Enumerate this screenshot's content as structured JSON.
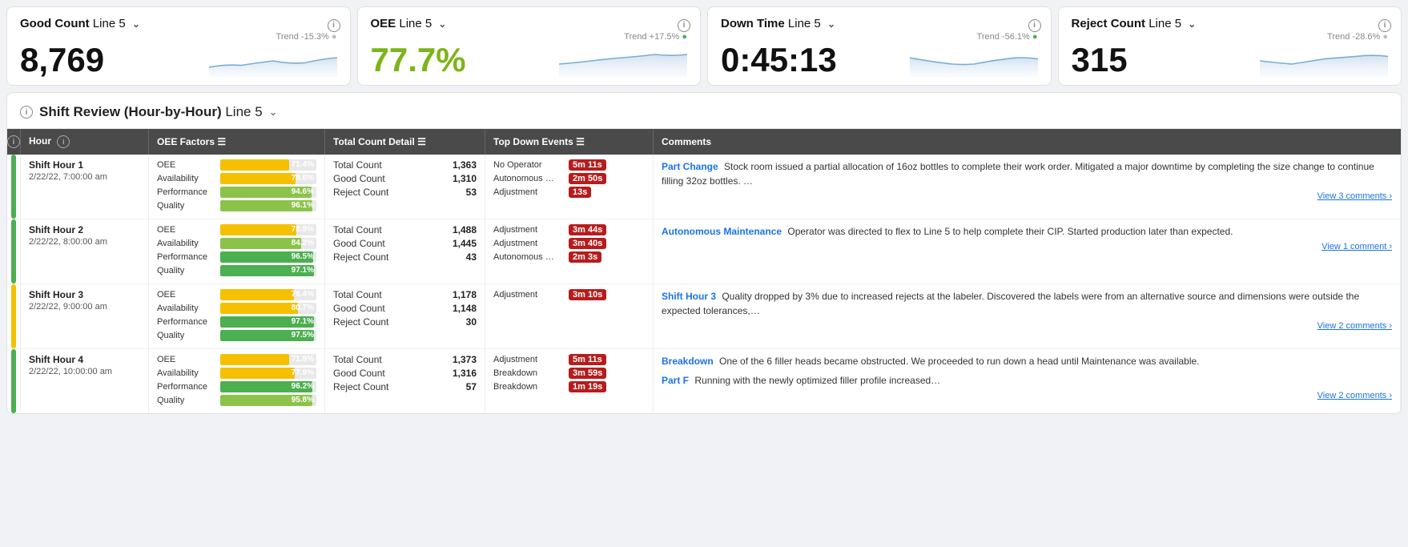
{
  "kpis": [
    {
      "id": "good-count",
      "title": "Good Count",
      "subtitle": "Line 5",
      "value": "8,769",
      "trend": "Trend -15.3%",
      "trend_direction": "gray",
      "value_color": "default"
    },
    {
      "id": "oee",
      "title": "OEE",
      "subtitle": "Line 5",
      "value": "77.7%",
      "trend": "Trend +17.5%",
      "trend_direction": "green",
      "value_color": "green"
    },
    {
      "id": "down-time",
      "title": "Down Time",
      "subtitle": "Line 5",
      "value": "0:45:13",
      "trend": "Trend -56.1%",
      "trend_direction": "green",
      "value_color": "default"
    },
    {
      "id": "reject-count",
      "title": "Reject Count",
      "subtitle": "Line 5",
      "value": "315",
      "trend": "Trend -28.6%",
      "trend_direction": "gray",
      "value_color": "default"
    }
  ],
  "shift_review": {
    "title": "Shift Review (Hour-by-Hour)",
    "subtitle": "Line 5",
    "columns": {
      "hour": "Hour",
      "oee_factors": "OEE Factors",
      "count_detail": "Total Count Detail",
      "down_events": "Top Down Events",
      "comments": "Comments"
    },
    "rows": [
      {
        "indicator": "green",
        "hour_label": "Shift Hour 1",
        "hour_date": "2/22/22, 7:00:00 am",
        "oee_factors": [
          {
            "label": "OEE",
            "pct": 71.4,
            "display": "71.4%",
            "color": "yellow"
          },
          {
            "label": "Availability",
            "pct": 78.6,
            "display": "78.6%",
            "color": "yellow"
          },
          {
            "label": "Performance",
            "pct": 94.6,
            "display": "94.6%",
            "color": "green-mid"
          },
          {
            "label": "Quality",
            "pct": 96.1,
            "display": "96.1%",
            "color": "green-mid"
          }
        ],
        "counts": [
          {
            "label": "Total Count",
            "value": "1,363"
          },
          {
            "label": "Good Count",
            "value": "1,310"
          },
          {
            "label": "Reject Count",
            "value": "53"
          }
        ],
        "down_events": [
          {
            "label": "No Operator",
            "time": "5m 11s"
          },
          {
            "label": "Autonomous …",
            "time": "2m 50s"
          },
          {
            "label": "Adjustment",
            "time": "13s"
          }
        ],
        "comments": [
          {
            "type": "Part Change",
            "text": "Stock room issued a partial allocation of 16oz bottles to complete their work order. Mitigated a major downtime by completing the size change to continue filling 32oz bottles. …",
            "view_link": "View 3 comments"
          }
        ]
      },
      {
        "indicator": "green",
        "hour_label": "Shift Hour 2",
        "hour_date": "2/22/22, 8:00:00 am",
        "oee_factors": [
          {
            "label": "OEE",
            "pct": 78.9,
            "display": "78.9%",
            "color": "yellow"
          },
          {
            "label": "Availability",
            "pct": 84.2,
            "display": "84.2%",
            "color": "green-mid"
          },
          {
            "label": "Performance",
            "pct": 96.5,
            "display": "96.5%",
            "color": "green-dark"
          },
          {
            "label": "Quality",
            "pct": 97.1,
            "display": "97.1%",
            "color": "green-dark"
          }
        ],
        "counts": [
          {
            "label": "Total Count",
            "value": "1,488"
          },
          {
            "label": "Good Count",
            "value": "1,445"
          },
          {
            "label": "Reject Count",
            "value": "43"
          }
        ],
        "down_events": [
          {
            "label": "Adjustment",
            "time": "3m 44s"
          },
          {
            "label": "Adjustment",
            "time": "3m 40s"
          },
          {
            "label": "Autonomous …",
            "time": "2m 3s"
          }
        ],
        "comments": [
          {
            "type": "Autonomous Maintenance",
            "text": "Operator was directed to flex to Line 5 to help complete their CIP. Started production later than expected.",
            "view_link": "View 1 comment"
          }
        ]
      },
      {
        "indicator": "yellow",
        "hour_label": "Shift Hour 3",
        "hour_date": "2/22/22, 9:00:00 am",
        "oee_factors": [
          {
            "label": "OEE",
            "pct": 76.4,
            "display": "76.4%",
            "color": "yellow"
          },
          {
            "label": "Availability",
            "pct": 80.7,
            "display": "80.7%",
            "color": "yellow"
          },
          {
            "label": "Performance",
            "pct": 97.1,
            "display": "97.1%",
            "color": "green-dark"
          },
          {
            "label": "Quality",
            "pct": 97.5,
            "display": "97.5%",
            "color": "green-dark"
          }
        ],
        "counts": [
          {
            "label": "Total Count",
            "value": "1,178"
          },
          {
            "label": "Good Count",
            "value": "1,148"
          },
          {
            "label": "Reject Count",
            "value": "30"
          }
        ],
        "down_events": [
          {
            "label": "Adjustment",
            "time": "3m 10s"
          }
        ],
        "comments": [
          {
            "type": "Shift Hour 3",
            "text": "Quality dropped by 3% due to increased rejects at the labeler. Discovered the labels were from an alternative source and dimensions were outside the expected tolerances,…",
            "view_link": "View 2 comments"
          }
        ]
      },
      {
        "indicator": "green",
        "hour_label": "Shift Hour 4",
        "hour_date": "2/22/22, 10:00:00 am",
        "oee_factors": [
          {
            "label": "OEE",
            "pct": 71.8,
            "display": "71.8%",
            "color": "yellow"
          },
          {
            "label": "Availability",
            "pct": 77.9,
            "display": "77.9%",
            "color": "yellow"
          },
          {
            "label": "Performance",
            "pct": 96.2,
            "display": "96.2%",
            "color": "green-dark"
          },
          {
            "label": "Quality",
            "pct": 95.8,
            "display": "95.8%",
            "color": "green-mid"
          }
        ],
        "counts": [
          {
            "label": "Total Count",
            "value": "1,373"
          },
          {
            "label": "Good Count",
            "value": "1,316"
          },
          {
            "label": "Reject Count",
            "value": "57"
          }
        ],
        "down_events": [
          {
            "label": "Adjustment",
            "time": "5m 11s"
          },
          {
            "label": "Breakdown",
            "time": "3m 59s"
          },
          {
            "label": "Breakdown",
            "time": "1m 19s"
          }
        ],
        "comments": [
          {
            "type": "Breakdown",
            "text": "One of the 6 filler heads became obstructed. We proceeded to run down a head until Maintenance was available."
          },
          {
            "type": "Part F",
            "text": "Running with the newly optimized filler profile increased…",
            "view_link": "View 2 comments"
          }
        ]
      }
    ]
  }
}
